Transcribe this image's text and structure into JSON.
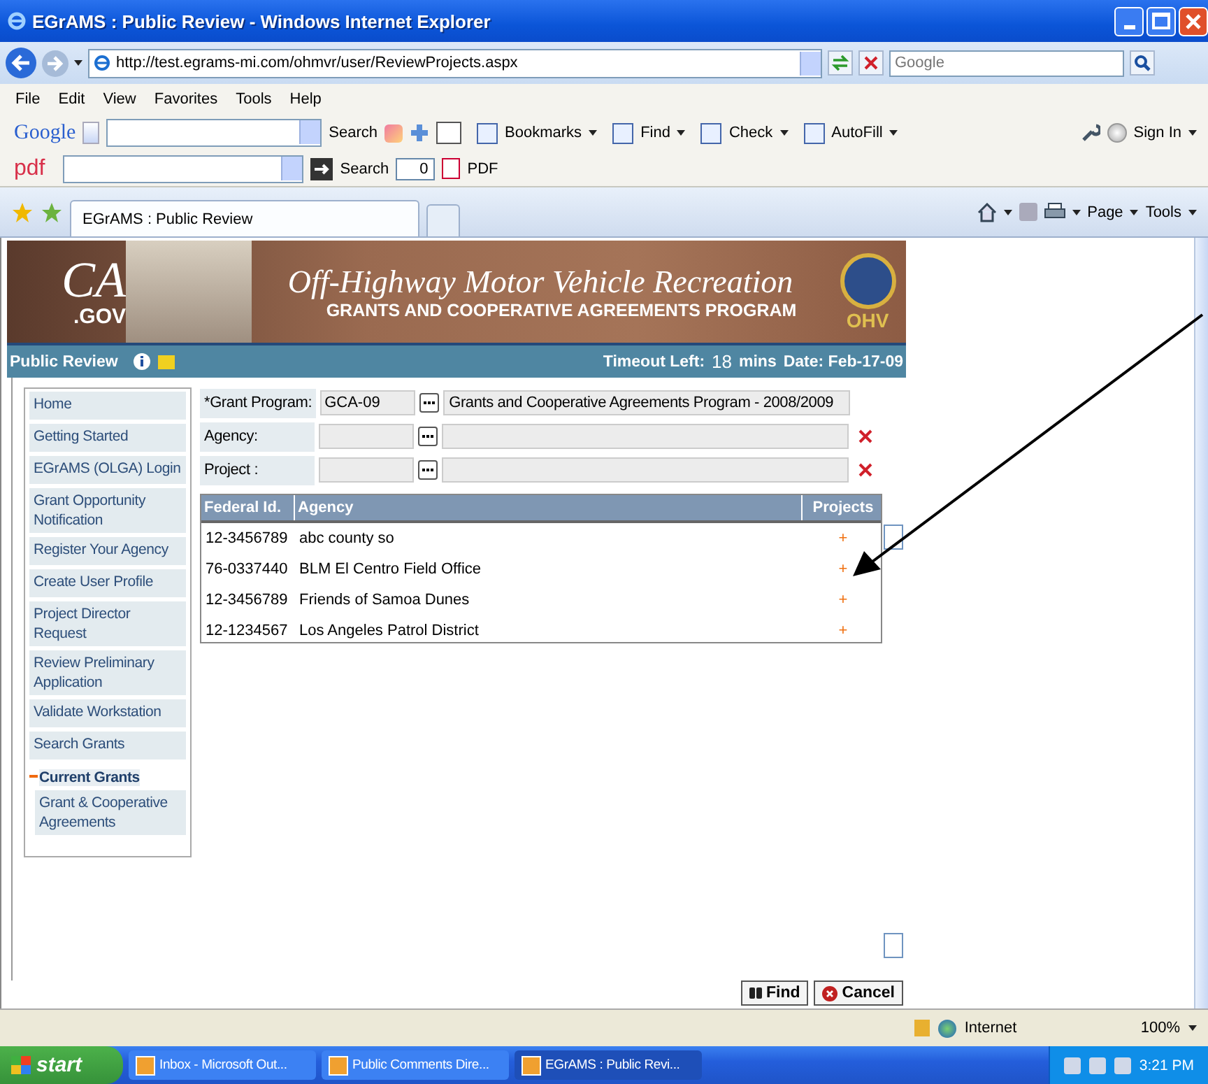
{
  "window": {
    "title": "EGrAMS : Public Review - Windows Internet Explorer"
  },
  "address_bar": {
    "url": "http://test.egrams-mi.com/ohmvr/user/ReviewProjects.aspx",
    "search_placeholder": "Google"
  },
  "menu": [
    "File",
    "Edit",
    "View",
    "Favorites",
    "Tools",
    "Help"
  ],
  "google_toolbar": {
    "logo": "Google",
    "search_label": "Search",
    "items": [
      "Bookmarks",
      "Find",
      "Check",
      "AutoFill"
    ],
    "sign_in": "Sign In"
  },
  "pdf_toolbar": {
    "logo": "pdf",
    "search_label": "Search",
    "count": "0",
    "pdf_label": "PDF"
  },
  "tabs": [
    {
      "label": "EGrAMS : Public Review",
      "selected": true
    }
  ],
  "command_bar": [
    "Page",
    "Tools"
  ],
  "banner": {
    "logo": "CA",
    "logo_suffix": ".GOV",
    "title": "Off-Highway Motor Vehicle Recreation",
    "subtitle": "GRANTS AND COOPERATIVE AGREEMENTS PROGRAM",
    "seal_text": "OHV"
  },
  "header": {
    "page": "Public Review",
    "timeout_label": "Timeout Left:",
    "timeout_value": "18",
    "timeout_unit": "mins",
    "date": "Date: Feb-17-09"
  },
  "sidebar": {
    "items": [
      {
        "label": "Home"
      },
      {
        "label": "Getting Started"
      },
      {
        "label": "EGrAMS (OLGA) Login"
      },
      {
        "label": "Grant Opportunity Notification"
      },
      {
        "label": "Register Your Agency"
      },
      {
        "label": "Create User Profile"
      },
      {
        "label": "Project Director Request"
      },
      {
        "label": "Review Preliminary Application"
      },
      {
        "label": "Validate Workstation"
      },
      {
        "label": "Search Grants"
      },
      {
        "label": "Current Grants",
        "expanded": true,
        "children": [
          {
            "label": "Grant & Cooperative Agreements"
          }
        ]
      }
    ]
  },
  "form": {
    "fields": [
      {
        "label": "*Grant Program:",
        "code": "GCA-09",
        "description": "Grants and Cooperative Agreements Program - 2008/2009",
        "clearable": false
      },
      {
        "label": "Agency:",
        "clearable": true
      },
      {
        "label": "Project :",
        "clearable": true
      }
    ]
  },
  "table": {
    "columns": [
      "Federal Id.",
      "Agency",
      "Projects"
    ],
    "rows": [
      {
        "federal_id": "12-3456789",
        "agency": "abc county so",
        "action": "+"
      },
      {
        "federal_id": "76-0337440",
        "agency": "BLM El Centro Field Office",
        "action": "+"
      },
      {
        "federal_id": "12-3456789",
        "agency": "Friends of Samoa Dunes",
        "action": "+"
      },
      {
        "federal_id": "12-1234567",
        "agency": "Los Angeles Patrol District",
        "action": "+"
      }
    ]
  },
  "buttons": [
    {
      "label": "Find",
      "kind": "find"
    },
    {
      "label": "Cancel",
      "kind": "cancel"
    }
  ],
  "status_bar": {
    "zone": "Internet",
    "zoom": "100%"
  },
  "taskbar": {
    "start": "start",
    "tasks": [
      {
        "label": "Inbox - Microsoft Out...",
        "selected": false
      },
      {
        "label": "Public Comments Dire...",
        "selected": false
      },
      {
        "label": "EGrAMS : Public Revi...",
        "selected": true
      }
    ],
    "clock": "3:21 PM"
  }
}
